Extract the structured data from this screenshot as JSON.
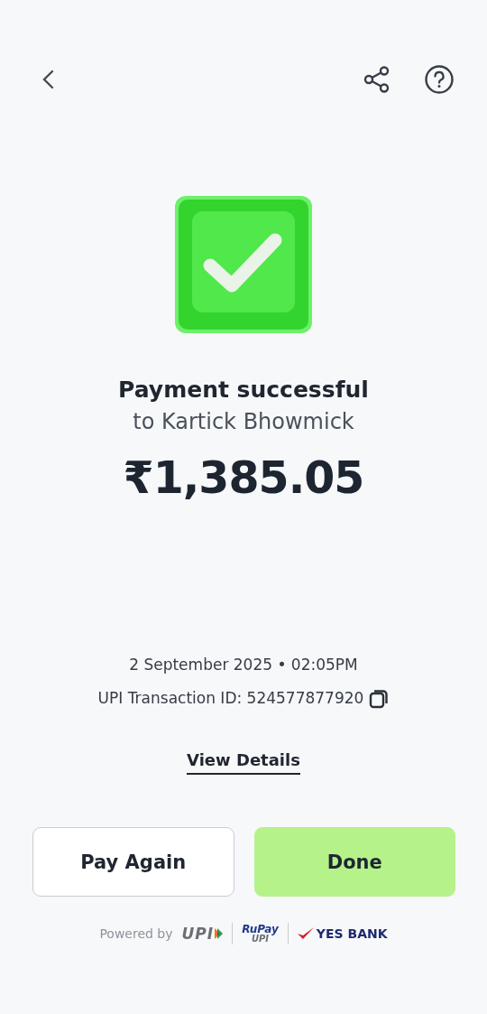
{
  "status": {
    "title": "Payment successful",
    "recipient": "to Kartick Bhowmick",
    "amount": "₹1,385.05"
  },
  "transaction": {
    "date": "2 September 2025",
    "time": "02:05PM",
    "separator": "•",
    "transaction_id_label": "UPI Transaction ID: 524577877920"
  },
  "view_details": "View Details",
  "buttons": [
    {
      "label": "Pay Again",
      "kind": "secondary"
    },
    {
      "label": "Done",
      "kind": "primary"
    }
  ],
  "footer": {
    "powered_by": "Powered by",
    "logos": [
      {
        "kind": "upi",
        "text": "UPI"
      },
      {
        "kind": "rupay",
        "text": "RuPay",
        "sub": "UPI"
      },
      {
        "kind": "bank",
        "text": "YES BANK"
      }
    ]
  }
}
